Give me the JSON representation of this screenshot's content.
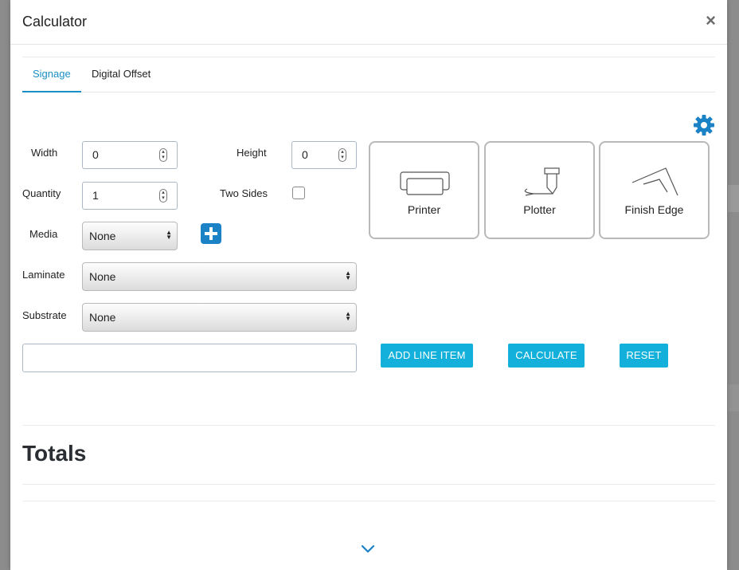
{
  "modal": {
    "title": "Calculator",
    "close_symbol": "×"
  },
  "tabs": [
    {
      "label": "Signage",
      "active": true
    },
    {
      "label": "Digital Offset",
      "active": false
    }
  ],
  "form": {
    "width_label": "Width",
    "width_value": "0",
    "height_label": "Height",
    "height_value": "0",
    "quantity_label": "Quantity",
    "quantity_value": "1",
    "two_sides_label": "Two Sides",
    "two_sides_checked": false,
    "media_label": "Media",
    "media_value": "None",
    "laminate_label": "Laminate",
    "laminate_value": "None",
    "substrate_label": "Substrate",
    "substrate_value": "None",
    "note_value": ""
  },
  "tiles": [
    {
      "label": "Printer",
      "icon": "printer-icon"
    },
    {
      "label": "Plotter",
      "icon": "plotter-icon"
    },
    {
      "label": "Finish Edge",
      "icon": "finish-edge-icon"
    }
  ],
  "actions": {
    "add_line_item": "ADD LINE ITEM",
    "calculate": "CALCULATE",
    "reset": "RESET"
  },
  "totals": {
    "heading": "Totals"
  },
  "colors": {
    "accent": "#1a8fc5",
    "button": "#12b0db",
    "plus": "#1b82c6"
  }
}
